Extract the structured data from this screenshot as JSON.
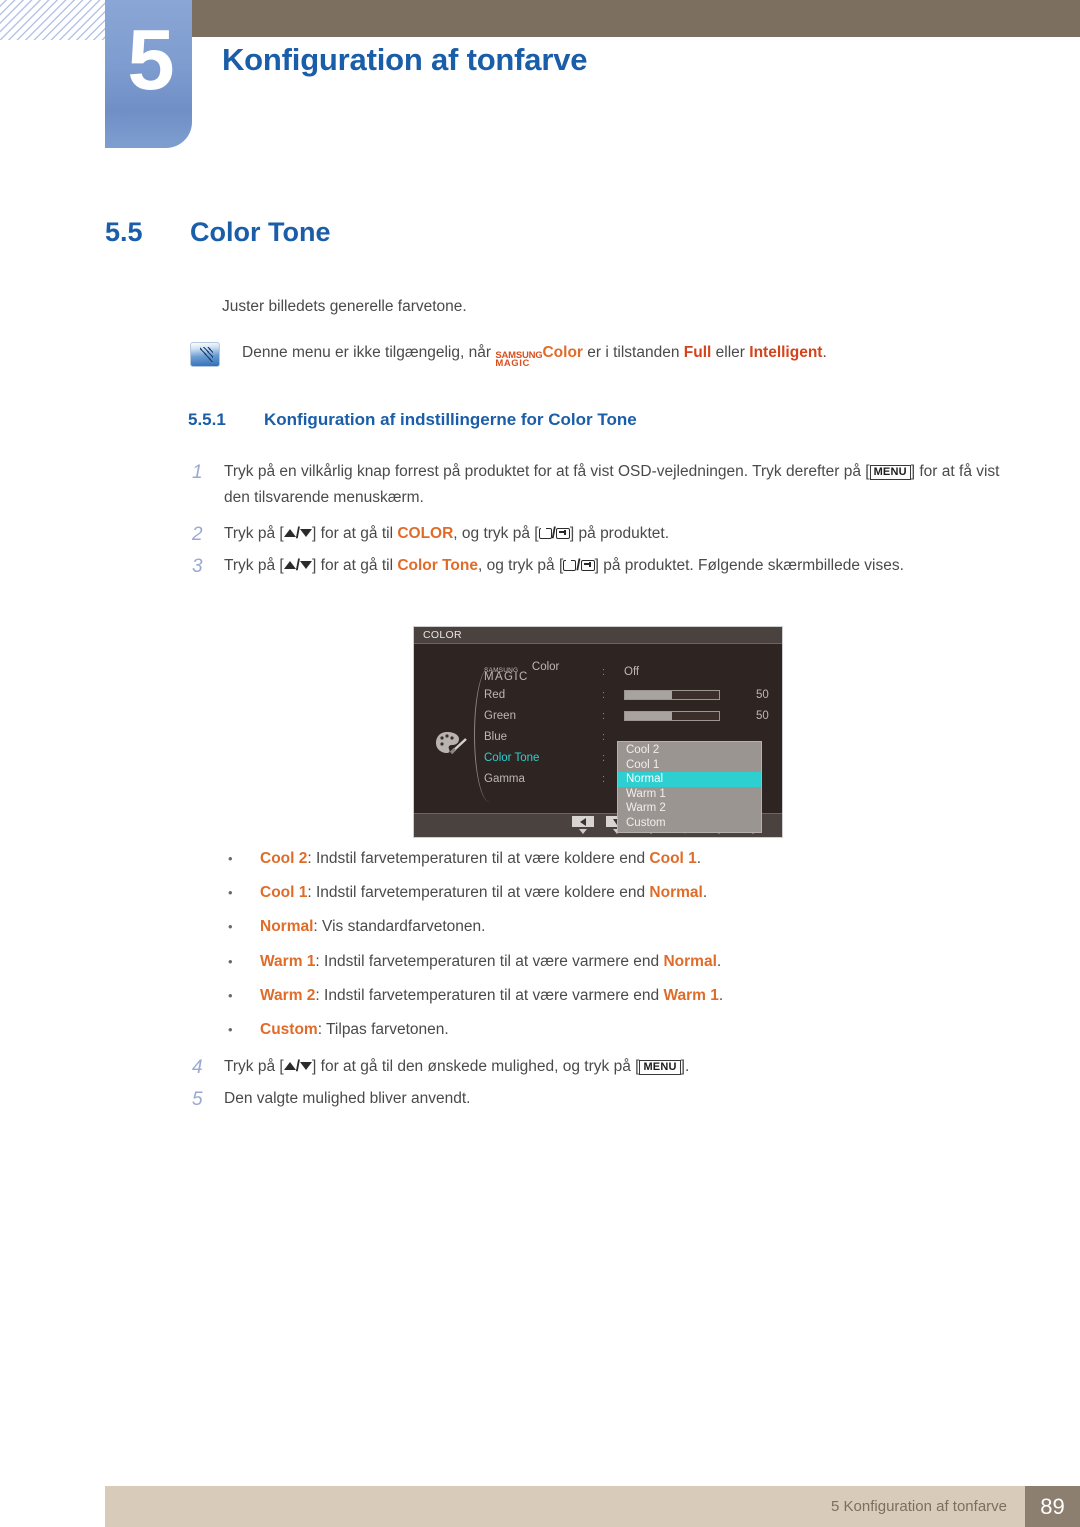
{
  "header": {
    "chapter_number": "5",
    "chapter_title": "Konfiguration af tonfarve"
  },
  "section": {
    "number": "5.5",
    "name": "Color Tone"
  },
  "intro": "Juster billedets generelle farvetone.",
  "note": {
    "text_before": "Denne menu er ikke tilgængelig, når",
    "magic_line1": "SAMSUNG",
    "magic_line2": "MAGIC",
    "magic_color": "Color",
    "text_middle": "er i tilstanden",
    "mode_full": "Full",
    "text_or": "eller",
    "mode_intelligent": "Intelligent",
    "period": "."
  },
  "subsection": {
    "number": "5.5.1",
    "name": "Konfiguration af indstillingerne for Color Tone"
  },
  "steps": {
    "step1": {
      "num": "1",
      "part1": "Tryk på en vilkårlig knap forrest på produktet for at få vist OSD-vejledningen. Tryk derefter på [",
      "key": "MENU",
      "part2": "] for at få vist den tilsvarende menuskærm."
    },
    "step2": {
      "num": "2",
      "part1": "Tryk på [",
      "part2": "] for at gå til",
      "target": "COLOR",
      "part3": ", og tryk på [",
      "part4": "] på produktet."
    },
    "step3": {
      "num": "3",
      "part1": "Tryk på [",
      "part2": "] for at gå til",
      "target": "Color Tone",
      "part3": ", og tryk på [",
      "part4": "] på produktet. Følgende skærmbillede vises."
    },
    "step4": {
      "num": "4",
      "part1": "Tryk på [",
      "part2": "] for at gå til den ønskede mulighed, og tryk på [",
      "key": "MENU",
      "part3": "]."
    },
    "step5": {
      "num": "5",
      "text": "Den valgte mulighed bliver anvendt."
    }
  },
  "osd": {
    "title": "COLOR",
    "rows": {
      "magic_small": "SAMSUNG",
      "magic_big": "MAGIC",
      "magic_suffix": " Color",
      "magic_value": "Off",
      "red_label": "Red",
      "red_value": "50",
      "green_label": "Green",
      "green_value": "50",
      "blue_label": "Blue",
      "tone_label": "Color Tone",
      "gamma_label": "Gamma",
      "colon": ":"
    },
    "dropdown": [
      {
        "label": "Cool 2",
        "selected": false
      },
      {
        "label": "Cool 1",
        "selected": false
      },
      {
        "label": "Normal",
        "selected": true
      },
      {
        "label": "Warm 1",
        "selected": false
      },
      {
        "label": "Warm 2",
        "selected": false
      },
      {
        "label": "Custom",
        "selected": false
      }
    ],
    "footer_buttons": [
      {
        "name": "left-arrow",
        "label": ""
      },
      {
        "name": "down-arrow",
        "label": ""
      },
      {
        "name": "up-arrow",
        "label": ""
      },
      {
        "name": "right-arrow",
        "label": ""
      },
      {
        "name": "auto",
        "label": "AUTO"
      },
      {
        "name": "power",
        "label": "⏻"
      }
    ],
    "highlight_color": "#2dcfd0",
    "slider_percent": 50
  },
  "bullets": [
    {
      "dot": "•",
      "term": "Cool 2",
      "desc_before": ": Indstil farvetemperaturen til at være koldere end ",
      "ref": "Cool 1",
      "desc_after": "."
    },
    {
      "dot": "•",
      "term": "Cool 1",
      "desc_before": ": Indstil farvetemperaturen til at være koldere end ",
      "ref": "Normal",
      "desc_after": "."
    },
    {
      "dot": "•",
      "term": "Normal",
      "desc_before": ": Vis standardfarvetonen.",
      "ref": "",
      "desc_after": ""
    },
    {
      "dot": "•",
      "term": "Warm 1",
      "desc_before": ": Indstil farvetemperaturen til at være varmere end ",
      "ref": "Normal",
      "desc_after": "."
    },
    {
      "dot": "•",
      "term": "Warm 2",
      "desc_before": ": Indstil farvetemperaturen til at være varmere end ",
      "ref": "Warm 1",
      "desc_after": "."
    },
    {
      "dot": "•",
      "term": "Custom",
      "desc_before": ": Tilpas farvetonen.",
      "ref": "",
      "desc_after": ""
    }
  ],
  "footer": {
    "text": "5 Konfiguration af tonfarve",
    "page": "89"
  },
  "colors": {
    "heading_blue": "#1a5da8",
    "accent_orange": "#e06c2a",
    "accent_red": "#d4441c",
    "header_brown": "#7c6f5f",
    "footer_beige": "#d8cbba",
    "osd_cyan": "#2dcfd0"
  }
}
